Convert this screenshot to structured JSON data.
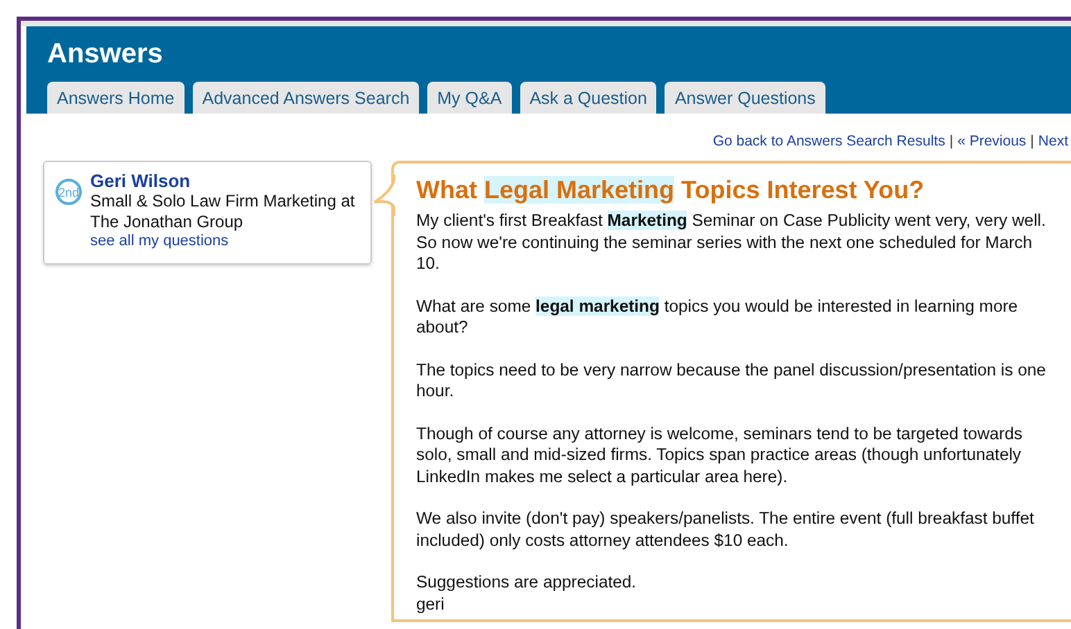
{
  "header": {
    "title": "Answers"
  },
  "tabs": [
    {
      "label": "Answers Home",
      "selected": false
    },
    {
      "label": "Advanced Answers Search",
      "selected": false
    },
    {
      "label": "My Q&A",
      "selected": false
    },
    {
      "label": "Ask a Question",
      "selected": false
    },
    {
      "label": "Answer Questions",
      "selected": false
    }
  ],
  "nav_links": [
    {
      "text": "Go back to Answers Search Results",
      "separator": "|"
    },
    {
      "text": "« Previous",
      "separator": "|"
    },
    {
      "text": "Next"
    }
  ],
  "author": {
    "badge": "2nd",
    "name": "Geri Wilson",
    "headline": "Small & Solo Law Firm Marketing at The Jonathan Group",
    "link": "see all my questions"
  },
  "question": {
    "title": [
      {
        "text": "What ",
        "highlight": false
      },
      {
        "text": "Legal ",
        "highlight": true
      },
      {
        "text": "Marketing",
        "highlight": true
      },
      {
        "text": " Topics Interest You?",
        "highlight": false
      }
    ],
    "paragraphs": [
      [
        {
          "text": "My client's first Breakfast ",
          "highlight": false
        },
        {
          "text": "Marketing",
          "highlight": true
        },
        {
          "text": " Seminar on Case Publicity went very, very well. So now we're continuing the seminar series with the next one scheduled for March 10.",
          "highlight": false
        }
      ],
      [
        {
          "text": "What are some ",
          "highlight": false
        },
        {
          "text": "legal ",
          "highlight": true
        },
        {
          "text": "marketing",
          "highlight": true
        },
        {
          "text": " topics you would be interested in learning more about?",
          "highlight": false
        }
      ],
      [
        {
          "text": "The topics need to be very narrow because the panel discussion/presentation is one hour.",
          "highlight": false
        }
      ],
      [
        {
          "text": "Though of course any attorney is welcome, seminars tend to be targeted towards solo, small and mid-sized firms. Topics span practice areas (though unfortunately LinkedIn makes me select a particular area here).",
          "highlight": false
        }
      ],
      [
        {
          "text": "We also invite (don't pay) speakers/panelists. The entire event (full breakfast buffet included) only costs attorney attendees $10 each.",
          "highlight": false
        }
      ],
      [
        {
          "text": "Suggestions are appreciated.",
          "highlight": false
        }
      ]
    ],
    "signature": "geri"
  }
}
